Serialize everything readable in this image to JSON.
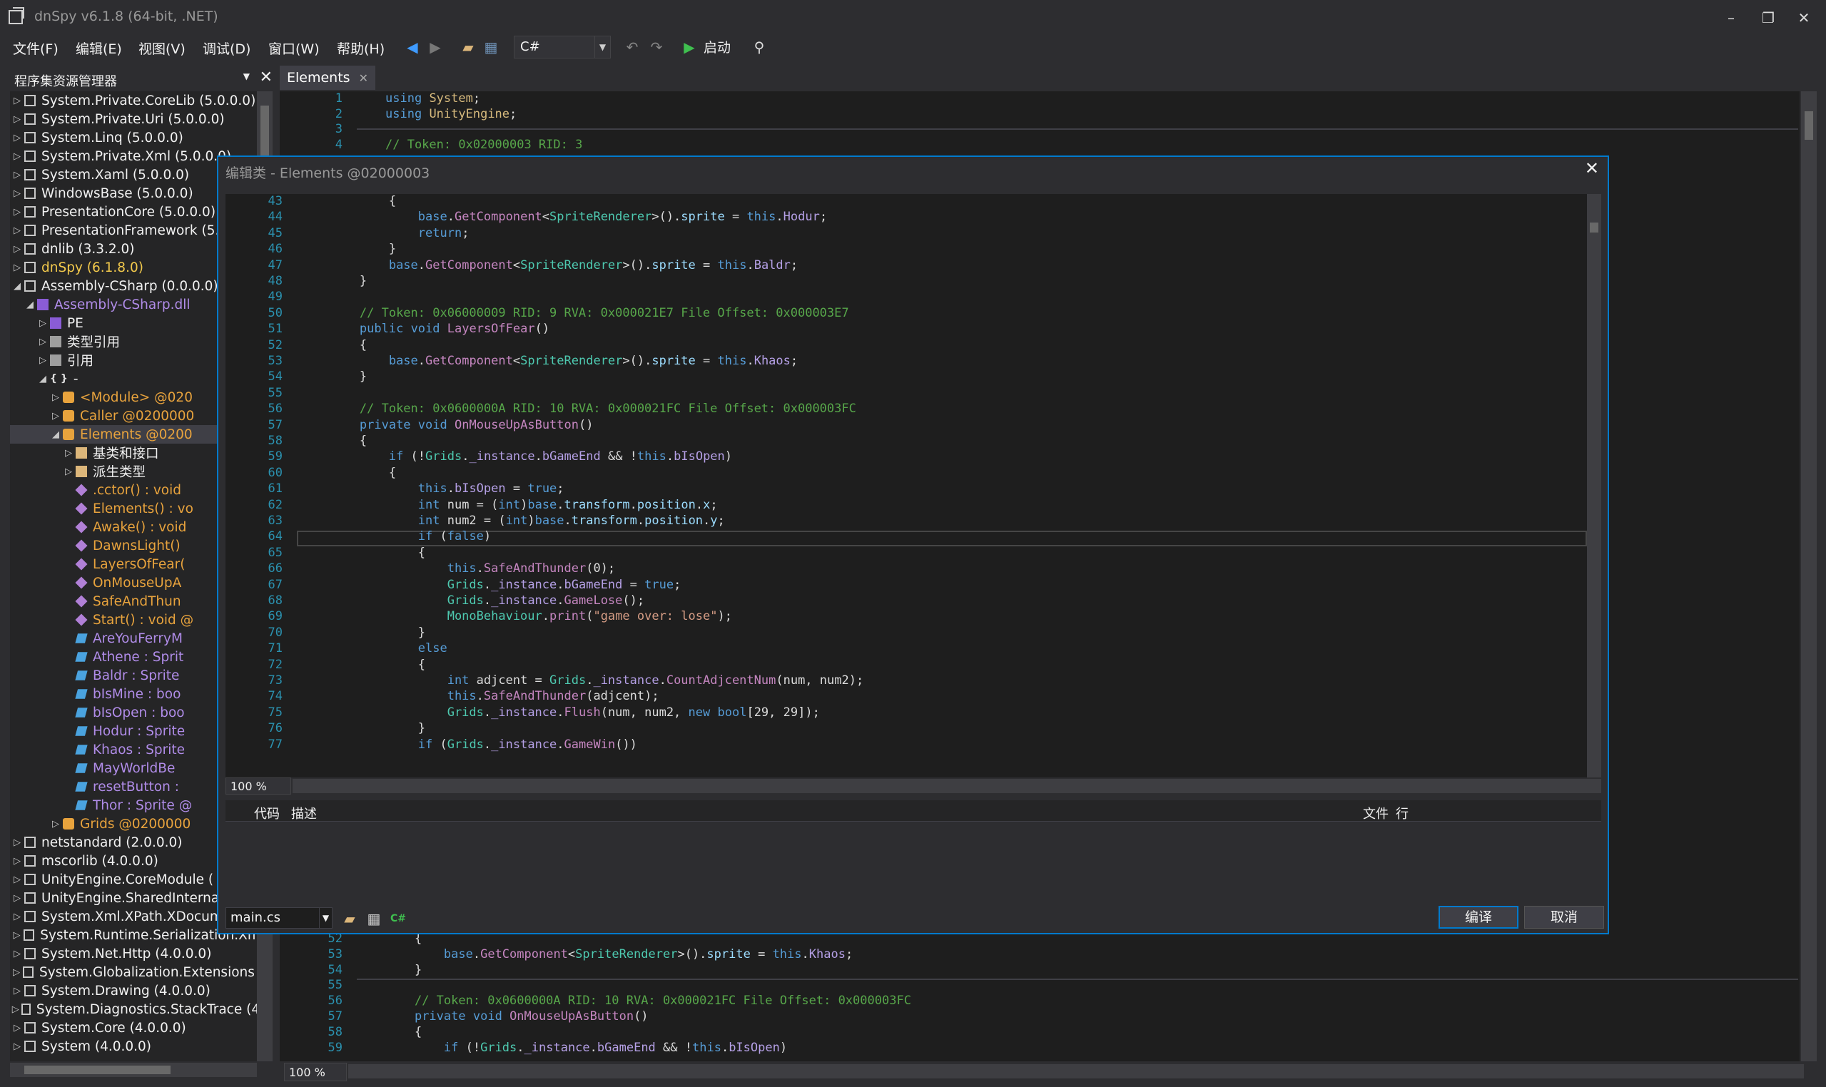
{
  "app": {
    "title": "dnSpy v6.1.8 (64-bit, .NET)"
  },
  "menu": [
    "文件(F)",
    "编辑(E)",
    "视图(V)",
    "调试(D)",
    "窗口(W)",
    "帮助(H)"
  ],
  "toolbar": {
    "language": "C#",
    "start_label": "启动"
  },
  "assembly_explorer": {
    "title": "程序集资源管理器",
    "nodes": [
      {
        "label": "System.Private.CoreLib (5.0.0.0)",
        "icon": "assembly-icon",
        "depth": 0,
        "exp": "▷",
        "style": ""
      },
      {
        "label": "System.Private.Uri (5.0.0.0)",
        "icon": "assembly-icon",
        "depth": 0,
        "exp": "▷",
        "style": ""
      },
      {
        "label": "System.Linq (5.0.0.0)",
        "icon": "assembly-icon",
        "depth": 0,
        "exp": "▷",
        "style": ""
      },
      {
        "label": "System.Private.Xml (5.0.0.0)",
        "icon": "assembly-icon",
        "depth": 0,
        "exp": "▷",
        "style": ""
      },
      {
        "label": "System.Xaml (5.0.0.0)",
        "icon": "assembly-icon",
        "depth": 0,
        "exp": "▷",
        "style": ""
      },
      {
        "label": "WindowsBase (5.0.0.0)",
        "icon": "assembly-icon",
        "depth": 0,
        "exp": "▷",
        "style": ""
      },
      {
        "label": "PresentationCore (5.0.0.0)",
        "icon": "assembly-icon",
        "depth": 0,
        "exp": "▷",
        "style": ""
      },
      {
        "label": "PresentationFramework (5.0",
        "icon": "assembly-icon",
        "depth": 0,
        "exp": "▷",
        "style": ""
      },
      {
        "label": "dnlib (3.3.2.0)",
        "icon": "assembly-icon",
        "depth": 0,
        "exp": "▷",
        "style": ""
      },
      {
        "label": "dnSpy (6.1.8.0)",
        "icon": "assembly-icon",
        "depth": 0,
        "exp": "▷",
        "style": "gold"
      },
      {
        "label": "Assembly-CSharp (0.0.0.0)",
        "icon": "assembly-icon",
        "depth": 0,
        "exp": "◢",
        "style": ""
      },
      {
        "label": "Assembly-CSharp.dll",
        "icon": "dll-icon",
        "depth": 1,
        "exp": "◢",
        "style": "purple"
      },
      {
        "label": "PE",
        "icon": "pe-icon",
        "depth": 2,
        "exp": "▷",
        "style": ""
      },
      {
        "label": "类型引用",
        "icon": "typeref-icon",
        "depth": 2,
        "exp": "▷",
        "style": ""
      },
      {
        "label": "引用",
        "icon": "reference-icon",
        "depth": 2,
        "exp": "▷",
        "style": ""
      },
      {
        "label": "-",
        "icon": "namespace-icon",
        "depth": 2,
        "exp": "◢",
        "style": ""
      },
      {
        "label": "<Module> @020",
        "icon": "class-icon",
        "depth": 3,
        "exp": "▷",
        "style": "orange"
      },
      {
        "label": "Caller @0200000",
        "icon": "class-icon",
        "depth": 3,
        "exp": "▷",
        "style": "orange"
      },
      {
        "label": "Elements @0200",
        "icon": "class-icon",
        "depth": 3,
        "exp": "◢",
        "style": "orange",
        "selected": true
      },
      {
        "label": "基类和接口",
        "icon": "folder-icon",
        "depth": 4,
        "exp": "▷",
        "style": ""
      },
      {
        "label": "派生类型",
        "icon": "folder-icon",
        "depth": 4,
        "exp": "▷",
        "style": ""
      },
      {
        "label": ".cctor() : void",
        "icon": "method-icon",
        "depth": 4,
        "exp": "",
        "style": "orange"
      },
      {
        "label": "Elements() : vo",
        "icon": "method-icon",
        "depth": 4,
        "exp": "",
        "style": "orange"
      },
      {
        "label": "Awake() : void",
        "icon": "method-icon",
        "depth": 4,
        "exp": "",
        "style": "orange"
      },
      {
        "label": "DawnsLight()",
        "icon": "method-icon",
        "depth": 4,
        "exp": "",
        "style": "orange"
      },
      {
        "label": "LayersOfFear(",
        "icon": "method-icon",
        "depth": 4,
        "exp": "",
        "style": "orange"
      },
      {
        "label": "OnMouseUpA",
        "icon": "method-icon",
        "depth": 4,
        "exp": "",
        "style": "orange"
      },
      {
        "label": "SafeAndThun",
        "icon": "method-icon",
        "depth": 4,
        "exp": "",
        "style": "orange"
      },
      {
        "label": "Start() : void @",
        "icon": "method-icon",
        "depth": 4,
        "exp": "",
        "style": "orange"
      },
      {
        "label": "AreYouFerryM",
        "icon": "field-icon",
        "depth": 4,
        "exp": "",
        "style": "purple"
      },
      {
        "label": "Athene : Sprit",
        "icon": "field-icon",
        "depth": 4,
        "exp": "",
        "style": "purple"
      },
      {
        "label": "Baldr : Sprite",
        "icon": "field-icon",
        "depth": 4,
        "exp": "",
        "style": "purple"
      },
      {
        "label": "bIsMine : boo",
        "icon": "field-icon",
        "depth": 4,
        "exp": "",
        "style": "purple"
      },
      {
        "label": "bIsOpen : boo",
        "icon": "field-icon",
        "depth": 4,
        "exp": "",
        "style": "purple"
      },
      {
        "label": "Hodur : Sprite",
        "icon": "field-icon",
        "depth": 4,
        "exp": "",
        "style": "purple"
      },
      {
        "label": "Khaos : Sprite",
        "icon": "field-icon",
        "depth": 4,
        "exp": "",
        "style": "purple"
      },
      {
        "label": "MayWorldBe",
        "icon": "field-icon",
        "depth": 4,
        "exp": "",
        "style": "purple"
      },
      {
        "label": "resetButton :",
        "icon": "field-icon",
        "depth": 4,
        "exp": "",
        "style": "purple"
      },
      {
        "label": "Thor : Sprite @",
        "icon": "field-icon",
        "depth": 4,
        "exp": "",
        "style": "purple"
      },
      {
        "label": "Grids @0200000",
        "icon": "class-icon",
        "depth": 3,
        "exp": "▷",
        "style": "orange"
      },
      {
        "label": "netstandard (2.0.0.0)",
        "icon": "assembly-icon",
        "depth": 0,
        "exp": "▷",
        "style": ""
      },
      {
        "label": "mscorlib (4.0.0.0)",
        "icon": "assembly-icon",
        "depth": 0,
        "exp": "▷",
        "style": ""
      },
      {
        "label": "UnityEngine.CoreModule (",
        "icon": "assembly-icon",
        "depth": 0,
        "exp": "▷",
        "style": ""
      },
      {
        "label": "UnityEngine.SharedInterna",
        "icon": "assembly-icon",
        "depth": 0,
        "exp": "▷",
        "style": ""
      },
      {
        "label": "System.Xml.XPath.XDocum",
        "icon": "assembly-icon",
        "depth": 0,
        "exp": "▷",
        "style": ""
      },
      {
        "label": "System.Runtime.Serialization.Xml",
        "icon": "assembly-icon",
        "depth": 0,
        "exp": "▷",
        "style": ""
      },
      {
        "label": "System.Net.Http (4.0.0.0)",
        "icon": "assembly-icon",
        "depth": 0,
        "exp": "▷",
        "style": ""
      },
      {
        "label": "System.Globalization.Extensions (",
        "icon": "assembly-icon",
        "depth": 0,
        "exp": "▷",
        "style": ""
      },
      {
        "label": "System.Drawing (4.0.0.0)",
        "icon": "assembly-icon",
        "depth": 0,
        "exp": "▷",
        "style": ""
      },
      {
        "label": "System.Diagnostics.StackTrace (4.",
        "icon": "assembly-icon",
        "depth": 0,
        "exp": "▷",
        "style": ""
      },
      {
        "label": "System.Core (4.0.0.0)",
        "icon": "assembly-icon",
        "depth": 0,
        "exp": "▷",
        "style": ""
      },
      {
        "label": "System (4.0.0.0)",
        "icon": "assembly-icon",
        "depth": 0,
        "exp": "▷",
        "style": ""
      }
    ]
  },
  "main_editor": {
    "tab": "Elements",
    "zoom": "100 %",
    "top_lines": [
      {
        "n": "1",
        "html": "<span class='kw'>using</span> <span class='orange-c'>System</span>;"
      },
      {
        "n": "2",
        "html": "<span class='kw'>using</span> <span class='orange-c'>UnityEngine</span>;"
      },
      {
        "n": "3",
        "html": ""
      },
      {
        "n": "4",
        "html": "<span class='cm'>// Token: 0x02000003 RID: 3</span>"
      }
    ],
    "bottom_lines": [
      {
        "n": "52",
        "html": "    {"
      },
      {
        "n": "53",
        "html": "        <span class='kw'>base</span>.<span class='meth-c'>GetComponent</span>&lt;<span class='type-c'>SpriteRenderer</span>&gt;().<span class='mem'>sprite</span> = <span class='kw'>this</span>.<span class='field-c'>Khaos</span>;"
      },
      {
        "n": "54",
        "html": "    }"
      },
      {
        "n": "55",
        "html": ""
      },
      {
        "n": "56",
        "html": "    <span class='cm'>// Token: 0x0600000A RID: 10 RVA: 0x000021FC File Offset: 0x000003FC</span>"
      },
      {
        "n": "57",
        "html": "    <span class='kw'>private</span> <span class='kw'>void</span> <span class='meth-c'>OnMouseUpAsButton</span>()"
      },
      {
        "n": "58",
        "html": "    {"
      },
      {
        "n": "59",
        "html": "        <span class='kw'>if</span> (!<span class='type-c'>Grids</span>.<span class='field-c'>_instance</span>.<span class='field-c'>bGameEnd</span> &amp;&amp; !<span class='kw'>this</span>.<span class='field-c'>bIsOpen</span>)"
      }
    ]
  },
  "dialog": {
    "title": "编辑类 - Elements @02000003",
    "zoom": "100 %",
    "error_columns": {
      "code": "代码",
      "description": "描述",
      "file": "文件",
      "line": "行"
    },
    "file": "main.cs",
    "compile_label": "编译",
    "cancel_label": "取消",
    "code_lines": [
      {
        "n": "43",
        "html": "            {"
      },
      {
        "n": "44",
        "html": "                <span class='kw'>base</span>.<span class='meth-c'>GetComponent</span>&lt;<span class='type-c'>SpriteRenderer</span>&gt;().<span class='mem'>sprite</span> = <span class='kw'>this</span>.<span class='field-c'>Hodur</span>;"
      },
      {
        "n": "45",
        "html": "                <span class='kw'>return</span>;"
      },
      {
        "n": "46",
        "html": "            }"
      },
      {
        "n": "47",
        "html": "            <span class='kw'>base</span>.<span class='meth-c'>GetComponent</span>&lt;<span class='type-c'>SpriteRenderer</span>&gt;().<span class='mem'>sprite</span> = <span class='kw'>this</span>.<span class='field-c'>Baldr</span>;"
      },
      {
        "n": "48",
        "html": "        }"
      },
      {
        "n": "49",
        "html": ""
      },
      {
        "n": "50",
        "html": "        <span class='cm'>// Token: 0x06000009 RID: 9 RVA: 0x000021E7 File Offset: 0x000003E7</span>"
      },
      {
        "n": "51",
        "html": "        <span class='kw'>public</span> <span class='kw'>void</span> <span class='meth-c'>LayersOfFear</span>()"
      },
      {
        "n": "52",
        "html": "        {"
      },
      {
        "n": "53",
        "html": "            <span class='kw'>base</span>.<span class='meth-c'>GetComponent</span>&lt;<span class='type-c'>SpriteRenderer</span>&gt;().<span class='mem'>sprite</span> = <span class='kw'>this</span>.<span class='field-c'>Khaos</span>;"
      },
      {
        "n": "54",
        "html": "        }"
      },
      {
        "n": "55",
        "html": ""
      },
      {
        "n": "56",
        "html": "        <span class='cm'>// Token: 0x0600000A RID: 10 RVA: 0x000021FC File Offset: 0x000003FC</span>"
      },
      {
        "n": "57",
        "html": "        <span class='kw'>private</span> <span class='kw'>void</span> <span class='meth-c'>OnMouseUpAsButton</span>()"
      },
      {
        "n": "58",
        "html": "        {"
      },
      {
        "n": "59",
        "html": "            <span class='kw'>if</span> (!<span class='type-c'>Grids</span>.<span class='field-c'>_instance</span>.<span class='field-c'>bGameEnd</span> &amp;&amp; !<span class='kw'>this</span>.<span class='field-c'>bIsOpen</span>)"
      },
      {
        "n": "60",
        "html": "            {"
      },
      {
        "n": "61",
        "html": "                <span class='kw'>this</span>.<span class='field-c'>bIsOpen</span> = <span class='kw'>true</span>;"
      },
      {
        "n": "62",
        "html": "                <span class='kw'>int</span> num = (<span class='kw'>int</span>)<span class='kw'>base</span>.<span class='mem'>transform</span>.<span class='mem'>position</span>.<span class='mem'>x</span>;"
      },
      {
        "n": "63",
        "html": "                <span class='kw'>int</span> num2 = (<span class='kw'>int</span>)<span class='kw'>base</span>.<span class='mem'>transform</span>.<span class='mem'>position</span>.<span class='mem'>y</span>;"
      },
      {
        "n": "64",
        "html": "                <span class='kw'>if</span> (<span class='kw'>false</span>)"
      },
      {
        "n": "65",
        "html": "                {"
      },
      {
        "n": "66",
        "html": "                    <span class='kw'>this</span>.<span class='meth-c'>SafeAndThunder</span>(0);"
      },
      {
        "n": "67",
        "html": "                    <span class='type-c'>Grids</span>.<span class='field-c'>_instance</span>.<span class='field-c'>bGameEnd</span> = <span class='kw'>true</span>;"
      },
      {
        "n": "68",
        "html": "                    <span class='type-c'>Grids</span>.<span class='field-c'>_instance</span>.<span class='meth-c'>GameLose</span>();"
      },
      {
        "n": "69",
        "html": "                    <span class='type-c'>MonoBehaviour</span>.<span class='meth-c'>print</span>(<span class='st'>\"game over: lose\"</span>);"
      },
      {
        "n": "70",
        "html": "                }"
      },
      {
        "n": "71",
        "html": "                <span class='kw'>else</span>"
      },
      {
        "n": "72",
        "html": "                {"
      },
      {
        "n": "73",
        "html": "                    <span class='kw'>int</span> adjcent = <span class='type-c'>Grids</span>.<span class='field-c'>_instance</span>.<span class='meth-c'>CountAdjcentNum</span>(num, num2);"
      },
      {
        "n": "74",
        "html": "                    <span class='kw'>this</span>.<span class='meth-c'>SafeAndThunder</span>(adjcent);"
      },
      {
        "n": "75",
        "html": "                    <span class='type-c'>Grids</span>.<span class='field-c'>_instance</span>.<span class='meth-c'>Flush</span>(num, num2, <span class='kw'>new</span> <span class='kw'>bool</span>[29, 29]);"
      },
      {
        "n": "76",
        "html": "                }"
      },
      {
        "n": "77",
        "html": "                <span class='kw'>if</span> (<span class='type-c'>Grids</span>.<span class='field-c'>_instance</span>.<span class='meth-c'>GameWin</span>())"
      }
    ]
  }
}
